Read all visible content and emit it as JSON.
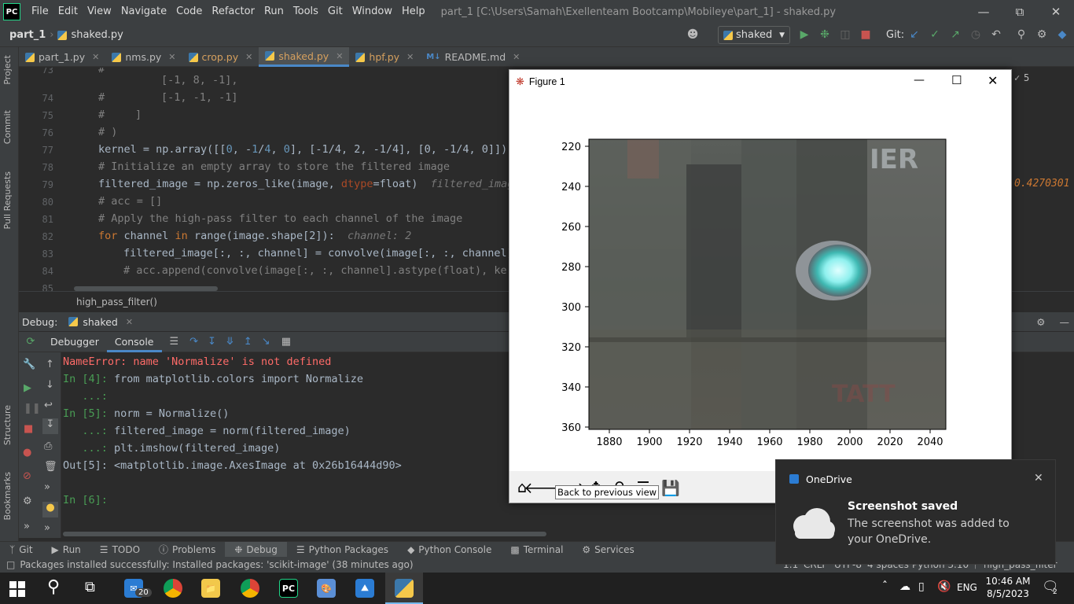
{
  "app": {
    "logo_text": "PC",
    "menu": [
      "File",
      "Edit",
      "View",
      "Navigate",
      "Code",
      "Refactor",
      "Run",
      "Tools",
      "Git",
      "Window",
      "Help"
    ],
    "window_title": "part_1 [C:\\Users\\Samah\\Exellenteam Bootcamp\\Mobileye\\part_1] - shaked.py"
  },
  "navbar": {
    "project": "part_1",
    "file": "shaked.py",
    "run_config": "shaked",
    "git_label": "Git:"
  },
  "left_strip": [
    "Project",
    "Commit",
    "Pull Requests",
    "Structure",
    "Bookmarks"
  ],
  "tabs": [
    {
      "label": "part_1.py"
    },
    {
      "label": "nms.py"
    },
    {
      "label": "crop.py"
    },
    {
      "label": "shaked.py",
      "active": true
    },
    {
      "label": "hpf.py"
    },
    {
      "label": "README.md"
    }
  ],
  "editor": {
    "line_numbers": [
      "73",
      "74",
      "75",
      "76",
      "77",
      "78",
      "79",
      "80",
      "81",
      "82",
      "83",
      "84",
      "85"
    ],
    "lines": {
      "l73a": "#",
      "l73b": "[-1, 8, -1],",
      "l74a": "#",
      "l74b": "[-1, -1, -1]",
      "l75a": "#",
      "l75b": "]",
      "l76": "# )",
      "l77a": "kernel = np.array([[",
      "l77n1": "0",
      "l77b": ", -",
      "l77n2": "1",
      "l77c": "/",
      "l77n3": "4",
      "l77d": ", ",
      "l77n4": "0",
      "l77e": "], [-1/4, 2, -1/4], [0, -1/4, 0]])",
      "l78": "# Initialize an empty array to store the filtered image",
      "l79a": "filtered_image = np.zeros_like(image, ",
      "l79p": "dtype",
      "l79b": "=float)",
      "l79hint": "filtered_imag",
      "l80": "# acc = []",
      "l81": "# Apply the high-pass filter to each channel of the image",
      "l82kw": "for",
      "l82a": " channel ",
      "l82kw2": "in",
      "l82b": " range(image.shape[2]):",
      "l82hint": "channel: 2",
      "l83": "filtered_image[:, :, channel] = convolve(image[:, :, channel]",
      "l84": "# acc.append(convolve(image[:, :, channel].astype(float), ker"
    },
    "right_value": "0.4270301",
    "right_badge": "5",
    "breadcrumb": "high_pass_filter()"
  },
  "debug": {
    "label": "Debug:",
    "session": "shaked",
    "tabs": [
      "Debugger",
      "Console"
    ],
    "console": {
      "c1": "NameError: name 'Normalize' is not defined",
      "c2p": "In [4]:",
      "c2": " from matplotlib.colors import Normalize",
      "c3p": "   ...:",
      "c4p": "In [5]:",
      "c4": " norm = Normalize()",
      "c5p": "   ...:",
      "c5": " filtered_image = norm(filtered_image)",
      "c6p": "   ...:",
      "c6": " plt.imshow(filtered_image)",
      "c7": "Out[5]: <matplotlib.image.AxesImage at 0x26b16444d90>",
      "c8p": "In [6]:"
    }
  },
  "bottom_tools": [
    "Git",
    "Run",
    "TODO",
    "Problems",
    "Debug",
    "Python Packages",
    "Python Console",
    "Terminal",
    "Services"
  ],
  "status": {
    "message": "Packages installed successfully: Installed packages: 'scikit-image' (38 minutes ago)",
    "position": "1:1",
    "line_sep": "CRLF",
    "encoding": "UTF-8",
    "indent": "4 spaces",
    "interpreter": "Python 3.10",
    "branch": "high_pass_filter"
  },
  "figure": {
    "title": "Figure 1",
    "y_ticks": [
      "220",
      "240",
      "260",
      "280",
      "300",
      "320",
      "340",
      "360"
    ],
    "x_ticks": [
      "1880",
      "1900",
      "1920",
      "1940",
      "1960",
      "1980",
      "2000",
      "2020",
      "2040"
    ],
    "image_text": [
      "IER",
      "TATT"
    ],
    "tooltip": "Back to previous view"
  },
  "toast": {
    "app": "OneDrive",
    "heading": "Screenshot saved",
    "body": "The screenshot was added to your OneDrive."
  },
  "taskbar": {
    "mail_badge": "20",
    "lang": "ENG",
    "time": "10:46 AM",
    "date": "8/5/2023",
    "notif_count": "2"
  }
}
